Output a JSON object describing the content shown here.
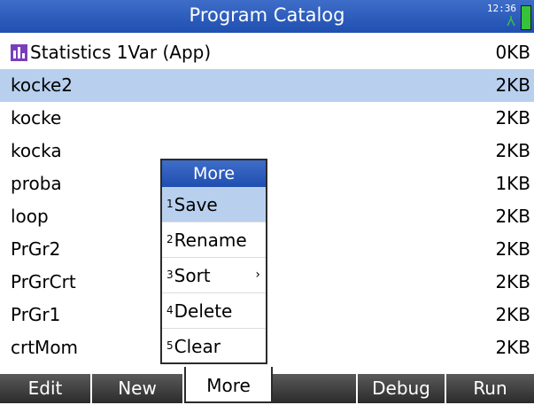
{
  "header": {
    "title": "Program Catalog",
    "clock": "12:36"
  },
  "programs": [
    {
      "name": "Statistics 1Var (App)",
      "size": "0KB",
      "app": true
    },
    {
      "name": "kocke2",
      "size": "2KB",
      "selected": true
    },
    {
      "name": "kocke",
      "size": "2KB"
    },
    {
      "name": "kocka",
      "size": "2KB"
    },
    {
      "name": "proba",
      "size": "1KB"
    },
    {
      "name": "loop",
      "size": "2KB"
    },
    {
      "name": "PrGr2",
      "size": "2KB"
    },
    {
      "name": "PrGrCrt",
      "size": "2KB"
    },
    {
      "name": "PrGr1",
      "size": "2KB"
    },
    {
      "name": "crtMom",
      "size": "2KB"
    }
  ],
  "menu": {
    "title": "More",
    "items": [
      {
        "num": "1",
        "label": "Save",
        "highlighted": true
      },
      {
        "num": "2",
        "label": "Rename"
      },
      {
        "num": "3",
        "label": "Sort",
        "arrow": "›"
      },
      {
        "num": "4",
        "label": "Delete"
      },
      {
        "num": "5",
        "label": "Clear"
      }
    ]
  },
  "softkeys": [
    "Edit",
    "New",
    "More",
    "",
    "Debug",
    "Run"
  ],
  "colors": {
    "accent": "#2a5bbd",
    "selection": "#b8d0ee",
    "softkey": "#3a3a3a",
    "battery": "#36c23b",
    "app_icon": "#7a3fb8"
  }
}
